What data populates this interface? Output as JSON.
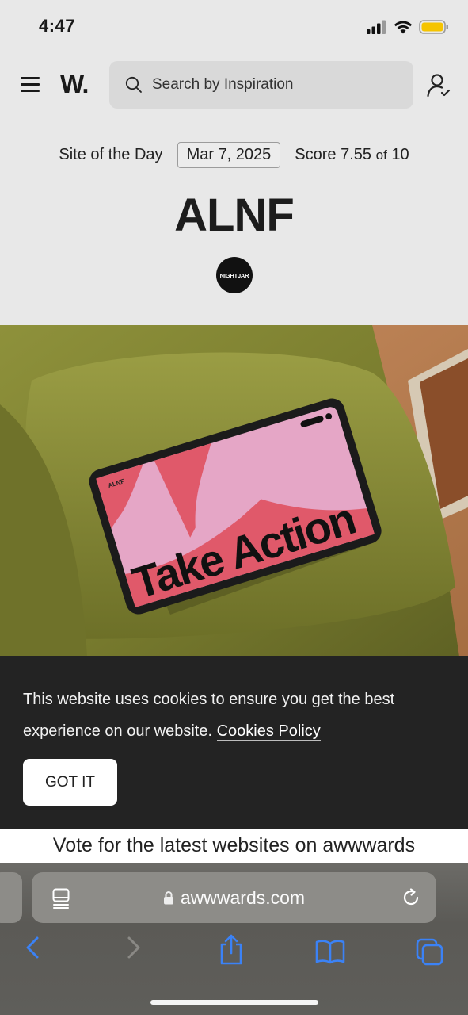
{
  "status_bar": {
    "time": "4:47"
  },
  "header": {
    "logo": "W.",
    "search_placeholder": "Search by Inspiration"
  },
  "sotd": {
    "label": "Site of the Day",
    "date": "Mar 7, 2025",
    "score_label": "Score",
    "score_value": "7.55",
    "score_of": "of",
    "score_max": "10",
    "site_name": "ALNF",
    "agency": "NIGHTJAR"
  },
  "hero": {
    "tablet_headline": "Take Action",
    "tablet_logo": "ALNF",
    "colors": {
      "sofa": "#7d7f30",
      "screen_pink": "#e5a6c6",
      "screen_red": "#e0596a"
    }
  },
  "cookie_banner": {
    "text": "This website uses cookies to ensure you get the best experience on our website.",
    "link": "Cookies Policy",
    "button": "GOT IT"
  },
  "vote_bar": {
    "text": "Vote for the latest websites on awwwards"
  },
  "browser": {
    "url": "awwwards.com",
    "accent": "#3b82f6"
  }
}
